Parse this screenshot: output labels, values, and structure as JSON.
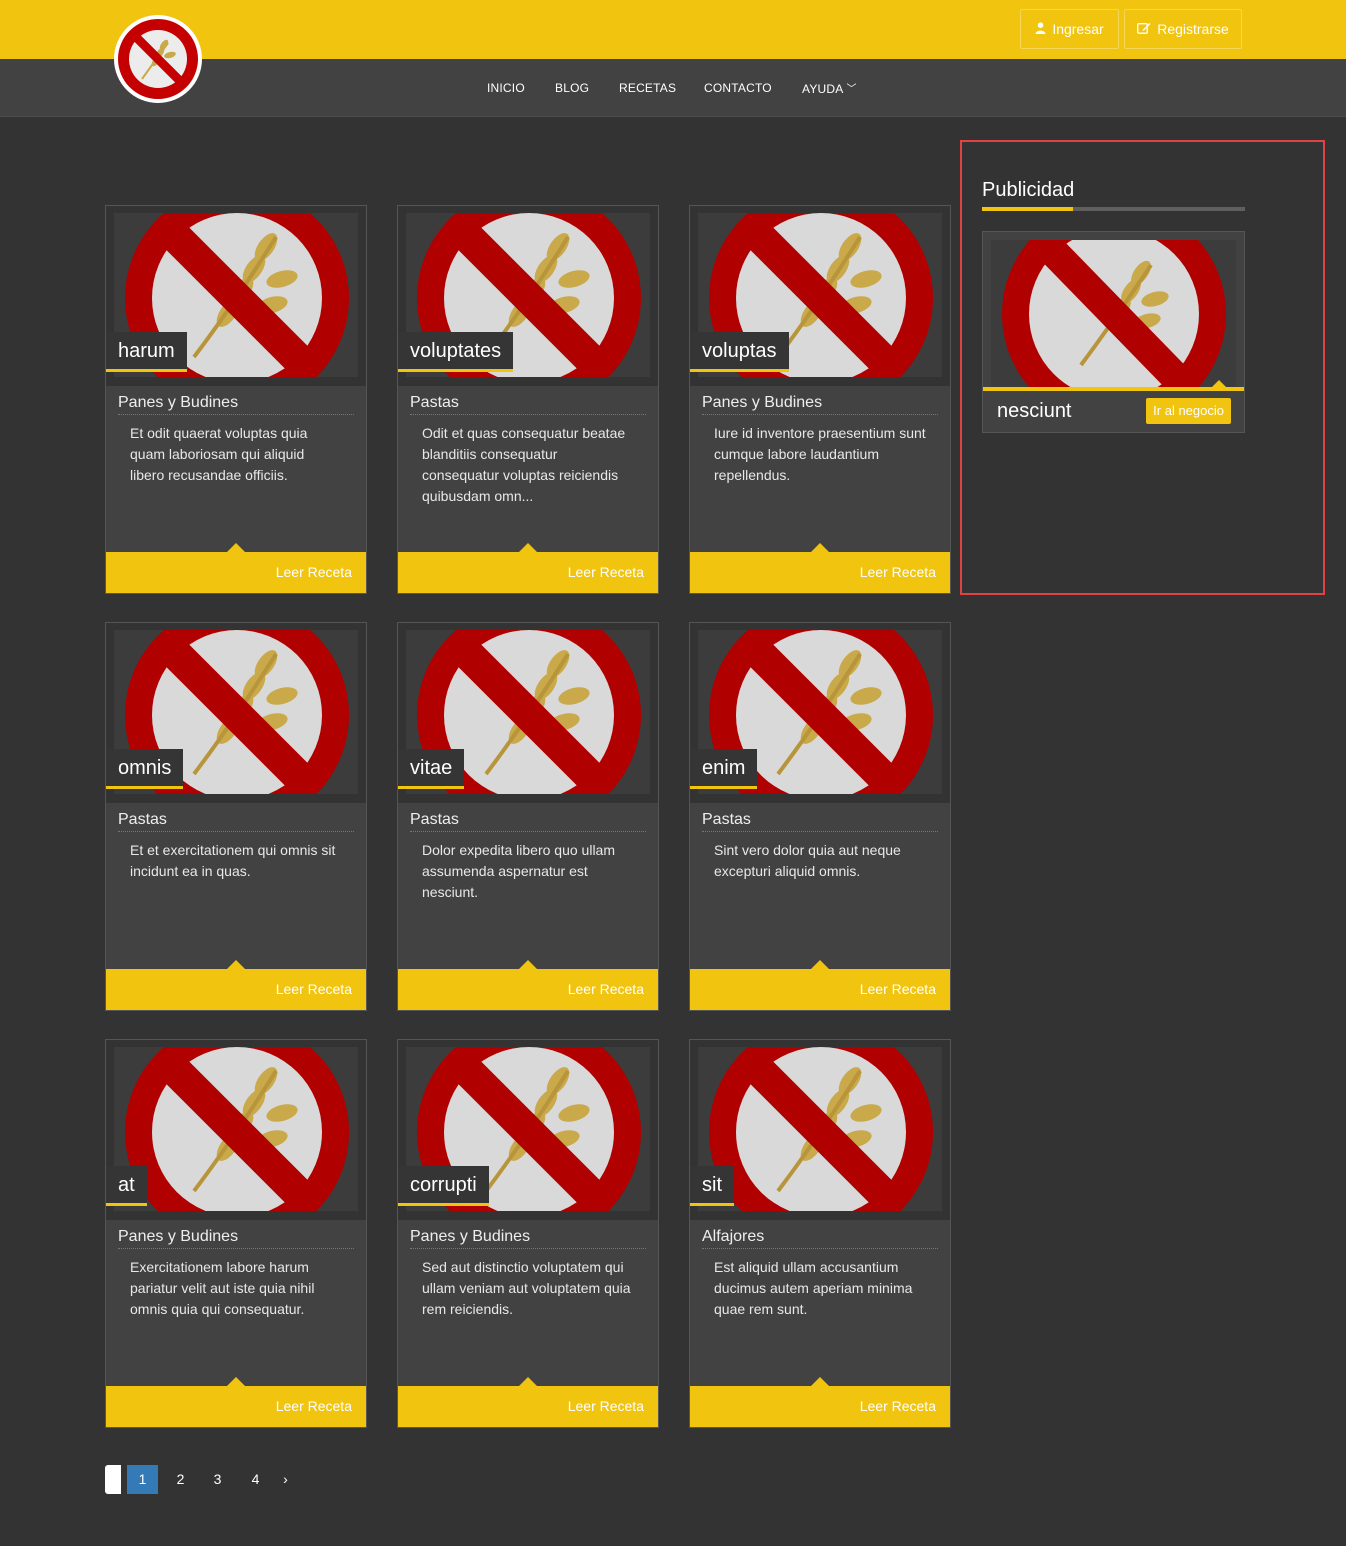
{
  "header": {
    "login_label": "Ingresar",
    "register_label": "Registrarse",
    "login_icon": "user-icon",
    "register_icon": "edit-icon"
  },
  "nav": {
    "items": [
      {
        "label": "INICIO"
      },
      {
        "label": "BLOG"
      },
      {
        "label": "RECETAS"
      },
      {
        "label": "CONTACTO"
      },
      {
        "label": "AYUDA"
      }
    ]
  },
  "colors": {
    "accent": "#f1c40f",
    "background": "#333333",
    "card": "#424242",
    "highlight_border": "#e04343",
    "active_page": "#337ab7"
  },
  "recipes": [
    {
      "title": "harum",
      "category": "Panes y Budines",
      "description": "Et odit quaerat voluptas quia quam laboriosam qui aliquid libero recusandae officiis.",
      "action": "Leer Receta"
    },
    {
      "title": "voluptates",
      "category": "Pastas",
      "description": "Odit et quas consequatur beatae blanditiis consequatur consequatur voluptas reiciendis quibusdam omn...",
      "action": "Leer Receta"
    },
    {
      "title": "voluptas",
      "category": "Panes y Budines",
      "description": "Iure id inventore praesentium sunt cumque labore laudantium repellendus.",
      "action": "Leer Receta"
    },
    {
      "title": "omnis",
      "category": "Pastas",
      "description": "Et et exercitationem qui omnis sit incidunt ea in quas.",
      "action": "Leer Receta"
    },
    {
      "title": "vitae",
      "category": "Pastas",
      "description": "Dolor expedita libero quo ullam assumenda aspernatur est nesciunt.",
      "action": "Leer Receta"
    },
    {
      "title": "enim",
      "category": "Pastas",
      "description": "Sint vero dolor quia aut neque excepturi aliquid omnis.",
      "action": "Leer Receta"
    },
    {
      "title": "at",
      "category": "Panes y Budines",
      "description": "Exercitationem labore harum pariatur velit aut iste quia nihil omnis quia qui consequatur.",
      "action": "Leer Receta"
    },
    {
      "title": "corrupti",
      "category": "Panes y Budines",
      "description": "Sed aut distinctio voluptatem qui ullam veniam aut voluptatem quia rem reiciendis.",
      "action": "Leer Receta"
    },
    {
      "title": "sit",
      "category": "Alfajores",
      "description": "Est aliquid ullam accusantium ducimus autem aperiam minima quae rem sunt.",
      "action": "Leer Receta"
    }
  ],
  "sidebar": {
    "heading": "Publicidad",
    "ad": {
      "name": "nesciunt",
      "action": "Ir al negocio"
    }
  },
  "pagination": {
    "pages": [
      "1",
      "2",
      "3",
      "4"
    ],
    "active": "1",
    "next": "›"
  }
}
